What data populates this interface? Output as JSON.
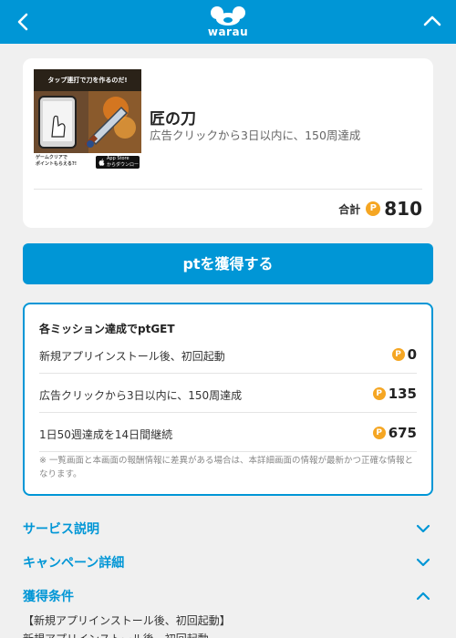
{
  "header": {
    "logo_text": "warau",
    "back_icon": "chevron-left-icon",
    "collapse_icon": "chevron-up-icon"
  },
  "offer": {
    "thumbnail": {
      "banner": "タップ連打で刀を作るのだ!",
      "caption_line1": "ゲームクリアで",
      "caption_line2": "ポイントもらえる?!",
      "store_line1": "App Store",
      "store_line2": "からダウンロード"
    },
    "title": "匠の刀",
    "subtitle": "広告クリックから3日以内に、150周達成",
    "total_label": "合計",
    "total_points": "810"
  },
  "cta_label": "ptを獲得する",
  "missions": {
    "heading": "各ミッション達成でptGET",
    "point_icon_label": "P",
    "items": [
      {
        "label": "新規アプリインストール後、初回起動",
        "points": "0"
      },
      {
        "label": "広告クリックから3日以内に、150周達成",
        "points": "135"
      },
      {
        "label": "1日50週達成を14日間継続",
        "points": "675"
      }
    ],
    "note": "※ 一覧画面と本画面の報酬情報に差異がある場合は、本詳細画面の情報が最新かつ正確な情報となります。"
  },
  "sections": [
    {
      "label": "サービス説明",
      "state": "collapsed"
    },
    {
      "label": "キャンペーン詳細",
      "state": "collapsed"
    },
    {
      "label": "獲得条件",
      "state": "expanded"
    }
  ],
  "conditions": [
    "【新規アプリインストール後、初回起動】",
    "新規アプリインストール後、初回起動"
  ],
  "colors": {
    "brand_blue": "#0096d6",
    "point_orange": "#f5a623",
    "background": "#f0f0f0"
  }
}
